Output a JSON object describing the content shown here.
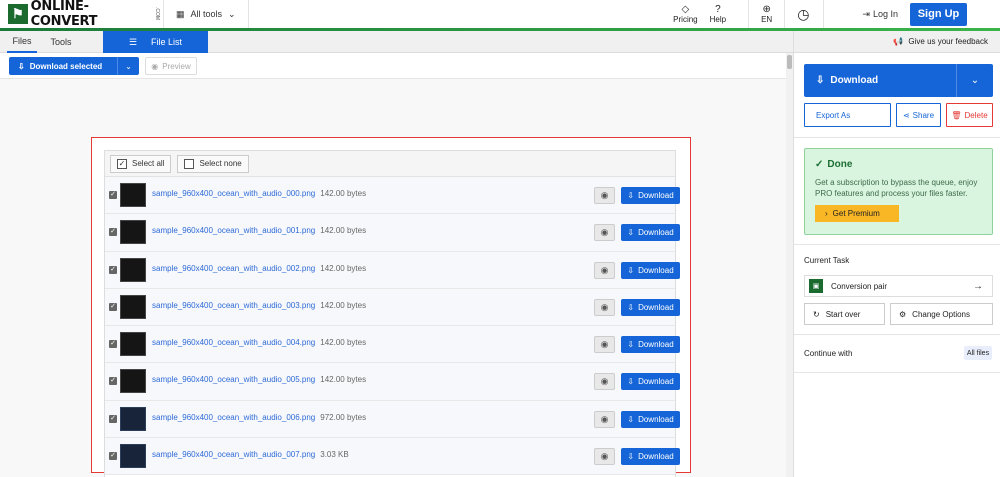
{
  "header": {
    "logo_text": "ONLINE-CONVERT",
    "logo_sub": ".COM",
    "all_tools": "All tools",
    "pricing": "Pricing",
    "help": "Help",
    "language": "EN",
    "login": "Log In",
    "signup": "Sign Up"
  },
  "tabs": {
    "files": "Files",
    "tools": "Tools",
    "file_list": "File List"
  },
  "toolbar": {
    "download_selected": "Download selected",
    "preview": "Preview"
  },
  "selection": {
    "select_all": "Select all",
    "select_none": "Select none"
  },
  "files": [
    {
      "name": "sample_960x400_ocean_with_audio_000.png",
      "size": "142.00 bytes",
      "thumb": "dark"
    },
    {
      "name": "sample_960x400_ocean_with_audio_001.png",
      "size": "142.00 bytes",
      "thumb": "dark"
    },
    {
      "name": "sample_960x400_ocean_with_audio_002.png",
      "size": "142.00 bytes",
      "thumb": "dark"
    },
    {
      "name": "sample_960x400_ocean_with_audio_003.png",
      "size": "142.00 bytes",
      "thumb": "dark"
    },
    {
      "name": "sample_960x400_ocean_with_audio_004.png",
      "size": "142.00 bytes",
      "thumb": "dark"
    },
    {
      "name": "sample_960x400_ocean_with_audio_005.png",
      "size": "142.00 bytes",
      "thumb": "dark"
    },
    {
      "name": "sample_960x400_ocean_with_audio_006.png",
      "size": "972.00 bytes",
      "thumb": "blue"
    },
    {
      "name": "sample_960x400_ocean_with_audio_007.png",
      "size": "3.03 KB",
      "thumb": "blue"
    }
  ],
  "row_download_label": "Download",
  "sidebar": {
    "feedback": "Give us your feedback",
    "download": "Download",
    "export_as": "Export As",
    "share": "Share",
    "delete": "Delete",
    "done_title": "Done",
    "done_message": "Get a subscription to bypass the queue, enjoy PRO features and process your files faster.",
    "get_premium": "Get Premium",
    "current_task": "Current Task",
    "conversion_pair": "Conversion pair",
    "start_over": "Start over",
    "change_options": "Change Options",
    "continue_with": "Continue with",
    "all_files": "All files"
  },
  "colors": {
    "accent": "#1565d8",
    "brand_green": "#1b6b2f",
    "danger": "#e53935",
    "premium": "#f9b625"
  }
}
